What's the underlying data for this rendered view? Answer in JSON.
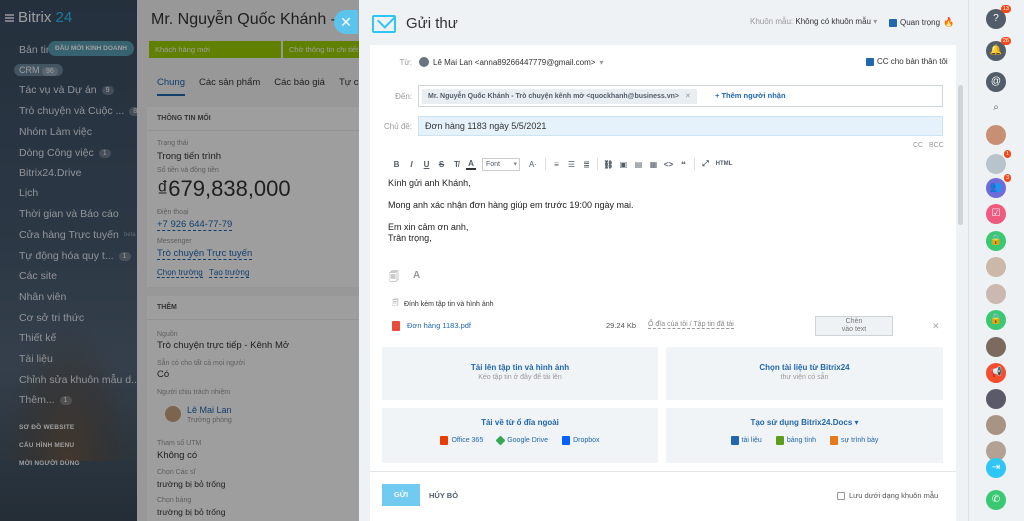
{
  "sidebar": {
    "brand": "Bitrix",
    "brand_num": "24",
    "pill": "ĐẦU MỚI KINH DOANH",
    "crm": "CRM",
    "crm_count": "96",
    "items": [
      {
        "label": "Bản tin",
        "count": ""
      },
      {
        "label": "Tác vụ và Dự án",
        "count": "9"
      },
      {
        "label": "Trò chuyện và Cuộc ...",
        "count": "8"
      },
      {
        "label": "Nhóm Làm việc",
        "count": ""
      },
      {
        "label": "Dòng Công việc",
        "count": "1"
      },
      {
        "label": "Bitrix24.Drive",
        "count": ""
      },
      {
        "label": "Lịch",
        "count": ""
      },
      {
        "label": "Thời gian và Báo cáo",
        "count": ""
      },
      {
        "label": "Cửa hàng Trực tuyến",
        "count": "beta"
      },
      {
        "label": "Tự động hóa quy t...",
        "count": "1"
      },
      {
        "label": "Các site",
        "count": ""
      },
      {
        "label": "Nhân viên",
        "count": ""
      },
      {
        "label": "Cơ sở tri thức",
        "count": ""
      },
      {
        "label": "Thiết kế",
        "count": ""
      },
      {
        "label": "Tài liệu",
        "count": ""
      },
      {
        "label": "Chỉnh sửa khuôn mẫu d...",
        "count": ""
      },
      {
        "label": "Thêm...",
        "count": "1"
      }
    ],
    "sections": [
      "SƠ ĐỒ WEBSITE",
      "CẤU HÌNH MENU",
      "MỜI NGƯỜI DÙNG"
    ]
  },
  "card": {
    "title": "Mr. Nguyễn Quốc Khánh - T",
    "stages": [
      "Khách hàng mới",
      "Chờ thông tin chi tiết"
    ],
    "tabs": [
      "Chung",
      "Các sản phẩm",
      "Các báo giá",
      "Tự c"
    ],
    "info_header": "THÔNG TIN MỐI",
    "status_label": "Trạng thái",
    "status_value": "Trong tiến trình",
    "amount_label": "Số tiền và đồng tiền",
    "amount_value": "₫679,838,000",
    "phone_label": "Điện thoại",
    "phone_value": "+7 926 644-77-79",
    "messenger_label": "Messenger",
    "messenger_value": "Trò chuyện Trực tuyến",
    "choose_route": "Chọn trường",
    "create_route": "Tạo trường",
    "more_header": "THÊM",
    "source_label": "Nguồn",
    "source_value": "Trò chuyện trực tiếp - Kênh Mở",
    "available_label": "Sẵn có cho tất cả mọi người",
    "available_value": "Có",
    "responsible_label": "Người chịu trách nhiệm",
    "responsible_name": "Lê Mai Lan",
    "responsible_role": "Trưởng phòng",
    "utm_label": "Tham số UTM",
    "utm_value": "Không có",
    "custom1_label": "Chọn Các sĩ",
    "custom1_value": "trường bị bỏ trống",
    "custom2_label": "Chọn bảng",
    "custom2_value": "trường bị bỏ trống"
  },
  "compose": {
    "title": "Gửi thư",
    "template_label": "Khuôn mẫu:",
    "template_value": "Không có khuôn mẫu",
    "important_label": "Quan trọng",
    "from_label": "Từ:",
    "from_value": "Lê Mai Lan <anna89266447779@gmail.com>",
    "cc_self_label": "CC cho bản thân tôi",
    "to_label": "Đến:",
    "to_chip": "Mr. Nguyễn Quốc Khánh - Trò chuyện kênh mở <quockhanh@business.vn>",
    "add_recipient": "+ Thêm người nhận",
    "subject_label": "Chủ đề:",
    "subject_value": "Đơn hàng 1183 ngày 5/5/2021",
    "cc": "CC",
    "bcc": "BCC",
    "toolbar": {
      "bold": "B",
      "italic": "I",
      "underline": "U",
      "strike": "S",
      "font_select": "Font",
      "font_size": "A·",
      "html": "HTML"
    },
    "body": {
      "greeting": "Kính gửi anh Khánh,",
      "line1": "Mong anh xác nhận đơn hàng giúp em trước 19:00 ngày mai.",
      "closing1": "Em xin cảm ơn anh,",
      "closing2": "Trân trọng,"
    },
    "attach_header": "Đính kèm tập tin và hình ảnh",
    "attachment": {
      "name": "Đơn hàng 1183.pdf",
      "size": "29.24 Kb",
      "storage": "Ổ đĩa của tôi / Tập tin đã tải",
      "insert_l1": "Chèn",
      "insert_l2": "vào text"
    },
    "upload": {
      "title": "Tải lên tập tin và hình ảnh",
      "sub": "Kéo tập tin ở đây để tải lên"
    },
    "choose_doc": {
      "title": "Chọn tài liệu từ Bitrix24",
      "sub": "thư viện có sẵn"
    },
    "external": {
      "title": "Tải về từ ổ đĩa ngoài",
      "office": "Office 365",
      "gdrive": "Google Drive",
      "dropbox": "Dropbox"
    },
    "create_docs": {
      "title": "Tạo sử dụng Bitrix24.Docs ▾",
      "doc": "tài liệu",
      "sheet": "bảng tính",
      "pres": "sự trình bày"
    },
    "send": "GỬI",
    "cancel": "HỦY BỎ",
    "save_template": "Lưu dưới dạng khuôn mẫu"
  },
  "rightbar": {
    "badges": {
      "notif": "13",
      "bell": "26",
      "group": "3",
      "chat": "1"
    }
  },
  "colors": {
    "accent": "#2fc6f6",
    "link": "#2067b0",
    "stage": "#9dcf00",
    "send": "#71caef"
  }
}
